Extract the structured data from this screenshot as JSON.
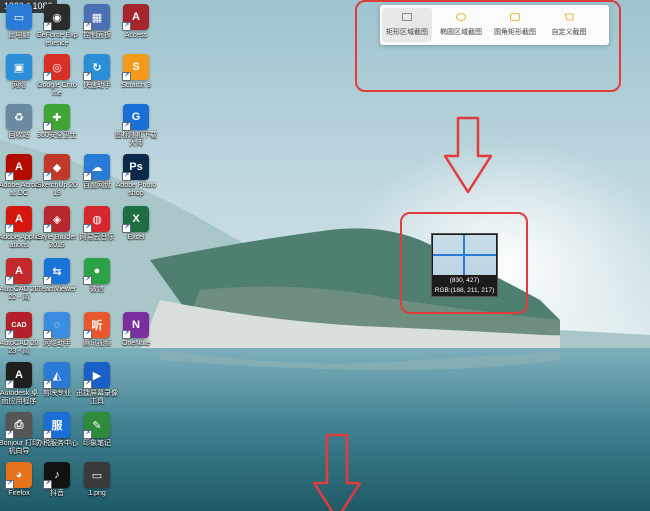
{
  "screen": {
    "resolution_label": "1920 * 1080"
  },
  "desktop_icons": [
    {
      "id": "computer",
      "label": "此电脑",
      "glyph": "▭",
      "color": "#2a7bd6",
      "col": 0,
      "row": 0
    },
    {
      "id": "geforce",
      "label": "GeForce Experience",
      "glyph": "◉",
      "color": "#2b2b2b",
      "col": 1,
      "row": 0
    },
    {
      "id": "control-panel",
      "label": "控制面板",
      "glyph": "▦",
      "color": "#4b6fb3",
      "col": 2,
      "row": 0
    },
    {
      "id": "access",
      "label": "Access",
      "glyph": "A",
      "color": "#a4262c",
      "col": 3,
      "row": 0
    },
    {
      "id": "network",
      "label": "网络",
      "glyph": "▣",
      "color": "#2a8fd6",
      "col": 0,
      "row": 1
    },
    {
      "id": "chrome",
      "label": "Google Chrome",
      "glyph": "◎",
      "color": "#d93025",
      "col": 1,
      "row": 1
    },
    {
      "id": "quick-help",
      "label": "快速助手",
      "glyph": "↻",
      "color": "#2a8fd6",
      "col": 2,
      "row": 1
    },
    {
      "id": "scratch",
      "label": "Scratch 3",
      "glyph": "S",
      "color": "#f59b1c",
      "col": 3,
      "row": 1
    },
    {
      "id": "recycle-bin",
      "label": "回收站",
      "glyph": "♻",
      "color": "#6a8aa0",
      "col": 0,
      "row": 2
    },
    {
      "id": "security-center",
      "label": "360安全卫士",
      "glyph": "✚",
      "color": "#3fa535",
      "col": 1,
      "row": 2
    },
    {
      "id": "unknown-tool",
      "label": "",
      "glyph": "",
      "color": "transparent",
      "col": 2,
      "row": 2
    },
    {
      "id": "g-drive",
      "label": "图标随机下载大师",
      "glyph": "G",
      "color": "#1a6fd6",
      "col": 3,
      "row": 2
    },
    {
      "id": "acrobat",
      "label": "Adobe Acrobat DC",
      "glyph": "A",
      "color": "#b30b00",
      "col": 0,
      "row": 3
    },
    {
      "id": "sketchup",
      "label": "SketchUp 2019",
      "glyph": "◆",
      "color": "#c0392b",
      "col": 1,
      "row": 3
    },
    {
      "id": "cloud-music",
      "label": "百度网盘",
      "glyph": "☁",
      "color": "#2a7bd6",
      "col": 2,
      "row": 3
    },
    {
      "id": "photoshop",
      "label": "Adobe Photoshop",
      "glyph": "Ps",
      "color": "#0b2a4a",
      "col": 3,
      "row": 3
    },
    {
      "id": "adobe-app",
      "label": "Adobe Applications",
      "glyph": "A",
      "color": "#d4180f",
      "col": 0,
      "row": 4
    },
    {
      "id": "style-builder",
      "label": "Style Builder 2019",
      "glyph": "◈",
      "color": "#b8262e",
      "col": 1,
      "row": 4
    },
    {
      "id": "netease-music",
      "label": "网易云音乐",
      "glyph": "◍",
      "color": "#d6262e",
      "col": 2,
      "row": 4
    },
    {
      "id": "excel",
      "label": "Excel",
      "glyph": "X",
      "color": "#1d6f42",
      "col": 3,
      "row": 4
    },
    {
      "id": "autocad",
      "label": "AutoCAD 2022 - 简",
      "glyph": "A",
      "color": "#c4282d",
      "col": 0,
      "row": 5
    },
    {
      "id": "teamviewer",
      "label": "TeamViewer",
      "glyph": "⇆",
      "color": "#1a73d6",
      "col": 1,
      "row": 5
    },
    {
      "id": "wechat",
      "label": "微信",
      "glyph": "●",
      "color": "#2ba245",
      "col": 2,
      "row": 5
    },
    {
      "id": "autocad2023",
      "label": "AutoCAD 2023 - 简",
      "glyph": "CAD",
      "color": "#b3202a",
      "col": 0,
      "row": 6
    },
    {
      "id": "browser",
      "label": "网络助手",
      "glyph": "◌",
      "color": "#3a8de0",
      "col": 1,
      "row": 6
    },
    {
      "id": "kingsoft",
      "label": "腾讯视频",
      "glyph": "听",
      "color": "#e8572e",
      "col": 2,
      "row": 6
    },
    {
      "id": "onenote",
      "label": "OneNote",
      "glyph": "N",
      "color": "#7b2f9e",
      "col": 3,
      "row": 6
    },
    {
      "id": "autodesk-app",
      "label": "Autodesk 桌面应用程序",
      "glyph": "A",
      "color": "#1f1f1f",
      "col": 0,
      "row": 7
    },
    {
      "id": "meitu",
      "label": "剪映专业",
      "glyph": "◭",
      "color": "#2a7bd6",
      "col": 1,
      "row": 7
    },
    {
      "id": "screen-recorder",
      "label": "迅捷屏幕录像工具",
      "glyph": "▶",
      "color": "#1a5fc8",
      "col": 2,
      "row": 7
    },
    {
      "id": "bonjour",
      "label": "Bonjour 打印机向导",
      "glyph": "⎙",
      "color": "#555555",
      "col": 0,
      "row": 8
    },
    {
      "id": "office-service",
      "label": "办税服务中心",
      "glyph": "服",
      "color": "#1a6fd6",
      "col": 1,
      "row": 8
    },
    {
      "id": "evernote",
      "label": "印象笔记",
      "glyph": "✎",
      "color": "#2e8b3a",
      "col": 2,
      "row": 8
    },
    {
      "id": "firefox",
      "label": "Firefox",
      "glyph": "◕",
      "color": "#e6731c",
      "col": 0,
      "row": 9
    },
    {
      "id": "tiktok",
      "label": "抖音",
      "glyph": "♪",
      "color": "#111111",
      "col": 1,
      "row": 9
    },
    {
      "id": "png-file",
      "label": "1.png",
      "glyph": "▭",
      "color": "#3a3a3a",
      "col": 2,
      "row": 9
    }
  ],
  "screenshot_toolbar": {
    "tools": [
      {
        "id": "rect",
        "label": "矩形区域截图",
        "active": true
      },
      {
        "id": "ellipse",
        "label": "椭圆区域截图",
        "active": false
      },
      {
        "id": "rounded",
        "label": "圆角矩形截图",
        "active": false
      },
      {
        "id": "custom",
        "label": "自定义截图",
        "active": false
      }
    ]
  },
  "magnifier": {
    "coords": "(830, 427)",
    "rgb": "RGB:(188, 211, 217)"
  },
  "colors": {
    "highlight": "#e23b3b",
    "crosshair": "#2a7bd6"
  }
}
